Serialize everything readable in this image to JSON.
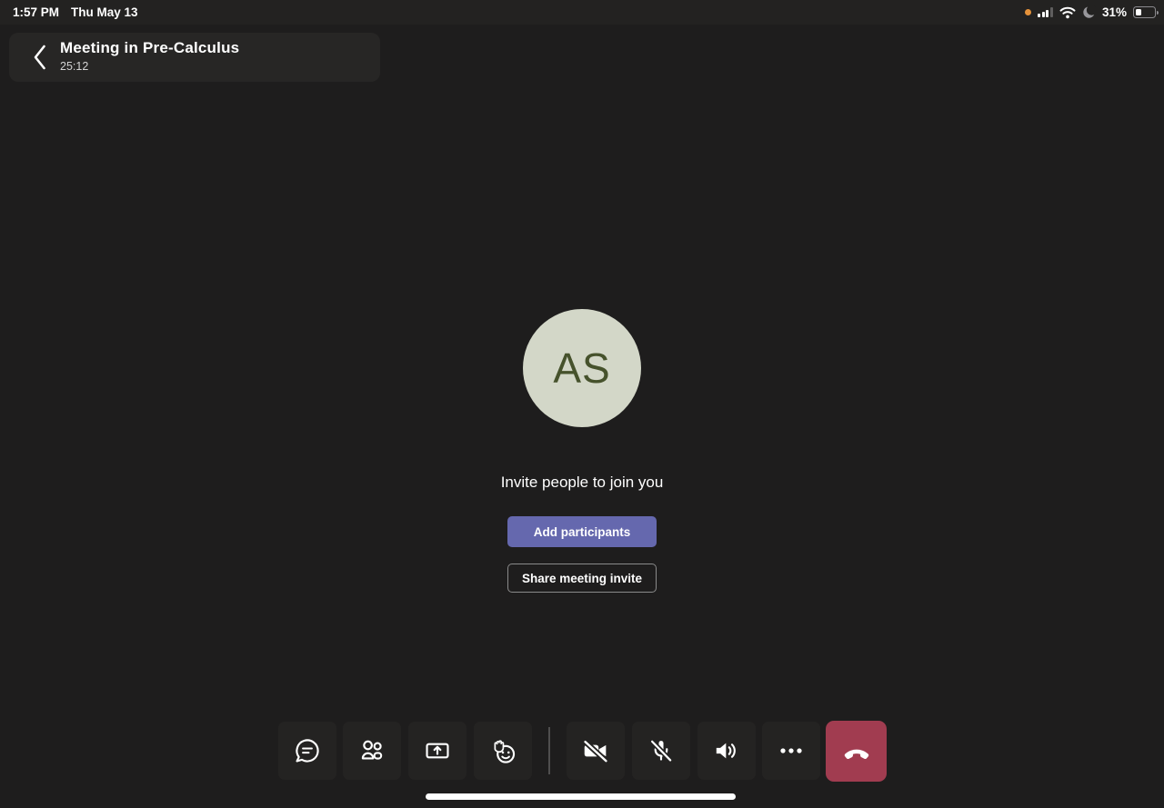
{
  "status_bar": {
    "time": "1:57 PM",
    "date": "Thu May 13",
    "battery_percent": "31%",
    "icons": {
      "recording_indicator": "orange-dot",
      "cellular": "signal-bars-3-of-4",
      "wifi": "wifi-icon",
      "focus_mode": "moon-icon",
      "battery": "battery-icon"
    }
  },
  "header": {
    "back_icon": "chevron-left-icon",
    "title": "Meeting in Pre-Calculus",
    "timer": "25:12"
  },
  "meeting_stage": {
    "avatar_initials": "AS",
    "invite_prompt": "Invite people to join you",
    "add_participants_button": "Add participants",
    "share_invite_button": "Share meeting invite"
  },
  "toolbar": {
    "buttons": [
      {
        "name": "chat",
        "icon": "chat-icon"
      },
      {
        "name": "participants",
        "icon": "people-icon"
      },
      {
        "name": "share-screen",
        "icon": "share-tray-icon"
      },
      {
        "name": "reactions",
        "icon": "raised-hand-smiley-icon"
      },
      {
        "name": "camera",
        "icon": "camera-off-icon",
        "state": "off"
      },
      {
        "name": "microphone",
        "icon": "mic-off-icon",
        "state": "muted"
      },
      {
        "name": "speaker",
        "icon": "speaker-icon",
        "state": "on"
      },
      {
        "name": "more",
        "icon": "ellipsis-icon"
      },
      {
        "name": "hang-up",
        "icon": "hang-up-icon"
      }
    ]
  },
  "colors": {
    "background": "#1e1d1d",
    "status_bar_bg": "#232221",
    "header_box_bg": "#272625",
    "accent_purple": "#6568ae",
    "hangup_red": "#a13c50",
    "avatar_bg": "#d3d7c8",
    "avatar_text": "#46522c",
    "recording_dot": "#e5923a"
  }
}
